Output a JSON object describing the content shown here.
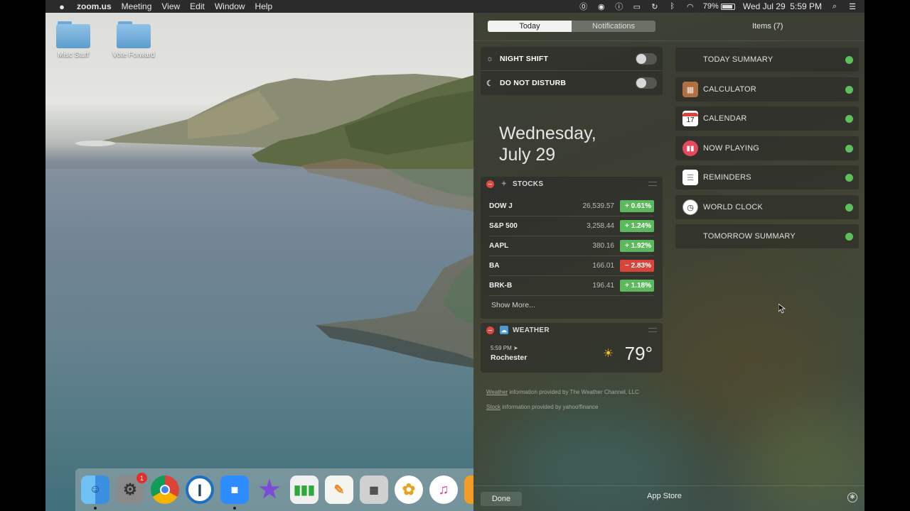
{
  "menubar": {
    "apple_icon": "apple-logo-icon",
    "app_name": "zoom.us",
    "menus": [
      "Meeting",
      "View",
      "Edit",
      "Window",
      "Help"
    ],
    "battery_percent": "79%",
    "datetime": "Wed Jul 29  5:59 PM",
    "status_icons": [
      "1password-icon",
      "zoom-status-icon",
      "accessibility-icon",
      "airplay-icon",
      "time-machine-icon",
      "bluetooth-icon",
      "wifi-icon"
    ]
  },
  "desktop": {
    "folders": [
      {
        "label": "Misc Stuff"
      },
      {
        "label": "Vote Forward"
      }
    ]
  },
  "dock": {
    "apps": [
      {
        "name": "finder-icon"
      },
      {
        "name": "system-preferences-icon",
        "badge": "1"
      },
      {
        "name": "chrome-icon"
      },
      {
        "name": "1password-icon"
      },
      {
        "name": "zoom-icon"
      },
      {
        "name": "imovie-icon"
      },
      {
        "name": "numbers-icon"
      },
      {
        "name": "pages-icon"
      },
      {
        "name": "calculator-icon"
      },
      {
        "name": "photos-icon"
      },
      {
        "name": "itunes-icon"
      },
      {
        "name": "ibooks-icon"
      }
    ]
  },
  "notification_center": {
    "tabs": {
      "today": "Today",
      "notifications": "Notifications"
    },
    "items_count": "Items (7)",
    "night_shift": "NIGHT SHIFT",
    "do_not_disturb": "DO NOT DISTURB",
    "date_line1": "Wednesday,",
    "date_line2": "July 29",
    "stocks": {
      "title": "STOCKS",
      "rows": [
        {
          "symbol": "DOW J",
          "price": "26,539.57",
          "change": "+ 0.61%",
          "dir": "up"
        },
        {
          "symbol": "S&P 500",
          "price": "3,258.44",
          "change": "+ 1.24%",
          "dir": "up"
        },
        {
          "symbol": "AAPL",
          "price": "380.16",
          "change": "+ 1.92%",
          "dir": "up"
        },
        {
          "symbol": "BA",
          "price": "166.01",
          "change": "− 2.83%",
          "dir": "down"
        },
        {
          "symbol": "BRK-B",
          "price": "196.41",
          "change": "+ 1.18%",
          "dir": "up"
        }
      ],
      "show_more": "Show More..."
    },
    "weather": {
      "title": "WEATHER",
      "time": "5:59 PM",
      "city": "Rochester",
      "temp": "79°"
    },
    "footnotes": {
      "weather_link": "Weather",
      "weather_text": " information provided by The Weather Channel, LLC",
      "stock_link": "Stock",
      "stock_text": " information provided by yahoo!finance"
    },
    "items": [
      {
        "label": "TODAY SUMMARY"
      },
      {
        "label": "CALCULATOR"
      },
      {
        "label": "CALENDAR",
        "day": "17"
      },
      {
        "label": "NOW PLAYING"
      },
      {
        "label": "REMINDERS"
      },
      {
        "label": "WORLD CLOCK"
      },
      {
        "label": "TOMORROW SUMMARY"
      }
    ],
    "footer": {
      "done": "Done",
      "app_store": "App Store"
    }
  }
}
